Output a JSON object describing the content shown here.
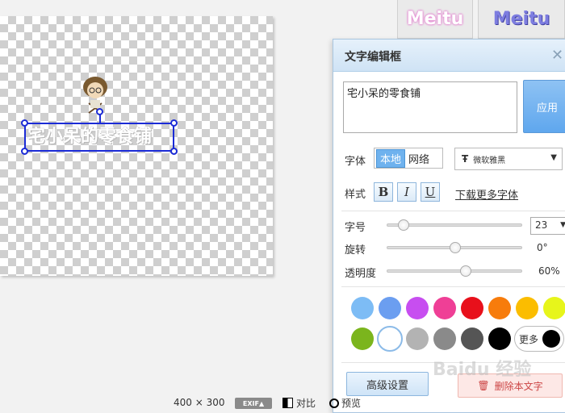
{
  "tabs": [
    "Meitu",
    "Meitu"
  ],
  "canvas": {
    "text": "宅小呆的零食铺"
  },
  "panel": {
    "title": "文字编辑框",
    "close": "✕",
    "text_value": "宅小呆的零食铺",
    "apply_label": "应用",
    "font_label": "字体",
    "font_source": [
      "本地",
      "网络"
    ],
    "font_name": "微软雅黑",
    "font_icon": "Ŧ",
    "style_label": "样式",
    "style_buttons": [
      "B",
      "I",
      "U"
    ],
    "more_fonts_label": "下载更多字体",
    "size_label": "字号",
    "size_value": "23",
    "rotate_label": "旋转",
    "rotate_value": "0°",
    "rotate_fraction": 0.5,
    "size_fraction": 0.12,
    "opacity_label": "透明度",
    "opacity_value": "60%",
    "opacity_fraction": 0.58,
    "colors_row1": [
      "#7dbcf5",
      "#6b9ef0",
      "#c74ef0",
      "#ef3f96",
      "#e8101b",
      "#f77c0c",
      "#fbbd00",
      "#e7f51b"
    ],
    "colors_row2": [
      "#7bb51d",
      "#ffffff",
      "#b3b3b3",
      "#8a8a8a",
      "#555555",
      "#000000"
    ],
    "more_colors_label": "更多",
    "advanced_label": "高级设置",
    "delete_label": "删除本文字"
  },
  "status": {
    "width": "400",
    "times": "×",
    "height": "300",
    "exif": "EXIF▲",
    "compare": "对比",
    "preview": "预览"
  },
  "watermark": "Baidu 经验"
}
